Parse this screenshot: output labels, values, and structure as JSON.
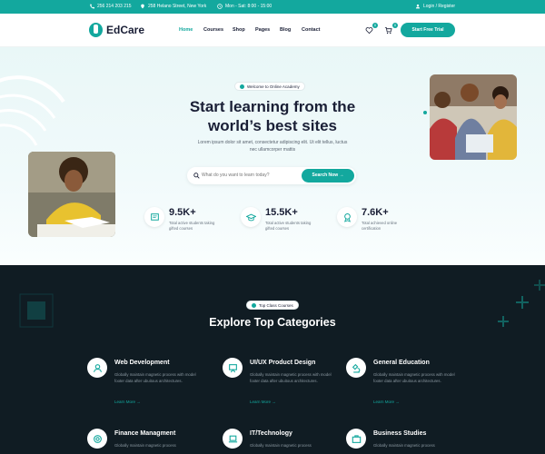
{
  "topbar": {
    "phone": "256 214 203 215",
    "address": "258 Helano Street, New York",
    "hours": "Mon - Sat: 8:00 - 15:00",
    "login": "Login / Register"
  },
  "nav": {
    "logo": "EdCare",
    "items": [
      {
        "label": "Home",
        "active": true
      },
      {
        "label": "Courses"
      },
      {
        "label": "Shop"
      },
      {
        "label": "Pages"
      },
      {
        "label": "Blog"
      },
      {
        "label": "Contact"
      }
    ],
    "wishlist_count": "0",
    "cart_count": "0",
    "cta": "Start Free Trial"
  },
  "hero": {
    "badge": "Welcome to Online Academy",
    "title_line1": "Start learning from the",
    "title_line2": "world’s best sites",
    "subtitle_line1": "Lorem ipsum dolor sit amet, consectetur adipiscing elit. Ut elit tellus, luctus",
    "subtitle_line2": "nec ullamcorper mattis",
    "search_placeholder": "What do you want to learn today?",
    "search_button": "Search Now →",
    "stats": [
      {
        "value": "9.5K+",
        "label": "Total active students taking gifted courses",
        "icon": "certificate-icon"
      },
      {
        "value": "15.5K+",
        "label": "Total active students taking gifted courses",
        "icon": "graduation-cap-icon"
      },
      {
        "value": "7.6K+",
        "label": "Total achieved online certification",
        "icon": "medal-icon"
      }
    ]
  },
  "categories": {
    "badge": "Top Class Courses",
    "title": "Explore Top Categories",
    "items": [
      {
        "title": "Web Development",
        "desc": "Globally maintain magnetic process with model footer data after ubuitous architectures.",
        "link": "Learn More →",
        "icon": "user-icon"
      },
      {
        "title": "UI/UX Product Design",
        "desc": "Globally maintain magnetic process with model footer data after ubuitous architectures.",
        "link": "Learn More →",
        "icon": "design-board-icon"
      },
      {
        "title": "General Education",
        "desc": "Globally maintain magnetic process with model footer data after ubuitous architectures.",
        "link": "Learn More →",
        "icon": "microscope-icon"
      },
      {
        "title": "Finance Managment",
        "desc": "Globally maintain magnetic process",
        "icon": "finance-icon"
      },
      {
        "title": "IT/Technology",
        "desc": "Globally maintain magnetic process",
        "icon": "laptop-icon"
      },
      {
        "title": "Business Studies",
        "desc": "Globally maintain magnetic process",
        "icon": "briefcase-icon"
      }
    ]
  },
  "colors": {
    "accent": "#13a89e",
    "dark": "#101c23",
    "text": "#1a1f36"
  }
}
